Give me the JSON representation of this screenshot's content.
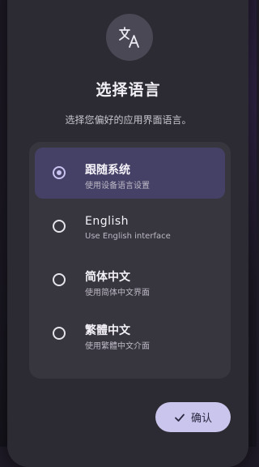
{
  "dialog": {
    "icon": "translate-icon",
    "title": "选择语言",
    "subtitle": "选择您偏好的应用界面语言。"
  },
  "options": [
    {
      "label": "跟随系统",
      "description": "使用设备语言设置",
      "selected": true
    },
    {
      "label": "English",
      "description": "Use English interface",
      "selected": false
    },
    {
      "label": "简体中文",
      "description": "使用简体中文界面",
      "selected": false
    },
    {
      "label": "繁體中文",
      "description": "使用繁體中文介面",
      "selected": false
    }
  ],
  "confirm": {
    "icon": "check-icon",
    "label": "确认"
  },
  "colors": {
    "dialog_bg": "#2c2a32",
    "list_bg": "#37353d",
    "selected_bg": "#454166",
    "accent": "#c8c3f0",
    "button_bg": "#c9c5ec"
  }
}
